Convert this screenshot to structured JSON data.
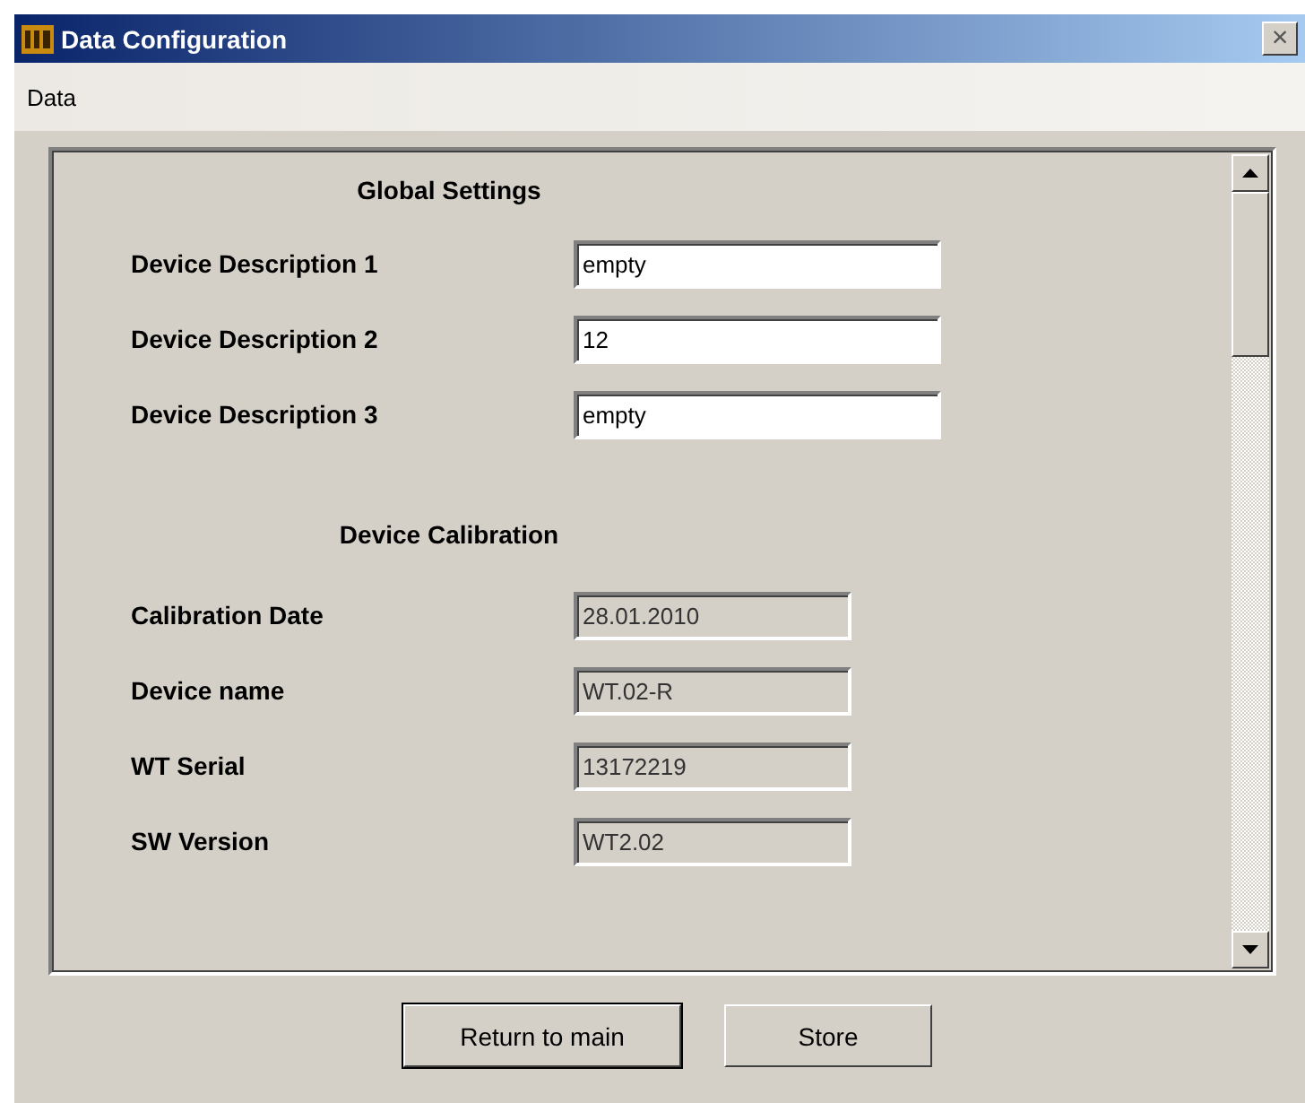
{
  "window": {
    "title": "Data Configuration",
    "close": "×"
  },
  "menu": [
    "Data"
  ],
  "sections": [
    {
      "heading": "Global Settings",
      "fields": [
        {
          "label": "Device Description 1",
          "value": "empty",
          "disabled": false
        },
        {
          "label": "Device Description 2",
          "value": "12",
          "disabled": false
        },
        {
          "label": "Device Description 3",
          "value": "empty",
          "disabled": false
        }
      ]
    },
    {
      "heading": "Device Calibration",
      "fields": [
        {
          "label": "Calibration Date",
          "value": "28.01.2010",
          "disabled": true
        },
        {
          "label": "Device name",
          "value": "WT.02-R",
          "disabled": true
        },
        {
          "label": "WT Serial",
          "value": "13172219",
          "disabled": true
        },
        {
          "label": "SW Version",
          "value": "WT2.02",
          "disabled": true
        }
      ]
    }
  ],
  "buttons": [
    {
      "label": "Return to main",
      "default": true
    },
    {
      "label": "Store",
      "default": false
    }
  ]
}
